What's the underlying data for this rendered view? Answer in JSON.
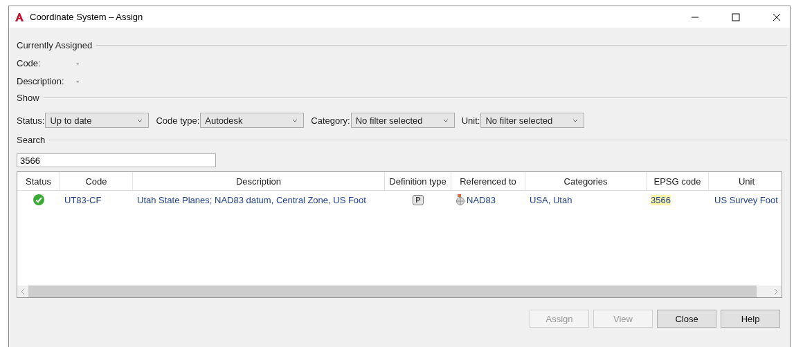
{
  "window": {
    "title": "Coordinate System – Assign"
  },
  "currently_assigned": {
    "heading": "Currently Assigned",
    "fields": [
      {
        "label": "Code:",
        "value": "-"
      },
      {
        "label": "Description:",
        "value": "-"
      }
    ]
  },
  "show": {
    "heading": "Show",
    "filters": [
      {
        "label": "Status:",
        "value": "Up to date"
      },
      {
        "label": "Code type:",
        "value": "Autodesk"
      },
      {
        "label": "Category:",
        "value": "No filter selected"
      },
      {
        "label": "Unit:",
        "value": "No filter selected"
      }
    ]
  },
  "search": {
    "heading": "Search",
    "value": "3566"
  },
  "table": {
    "columns": [
      "Status",
      "Code",
      "Description",
      "Definition type",
      "Referenced to",
      "Categories",
      "EPSG code",
      "Unit"
    ],
    "rows": [
      {
        "up_to_date": true,
        "code": "UT83-CF",
        "description": "Utah State Planes; NAD83 datum, Central Zone, US Foot",
        "definition_type": "P",
        "referenced_to": "NAD83",
        "categories": "USA, Utah",
        "epsg_code": "3566",
        "epsg_highlighted": true,
        "unit": "US Survey Foot"
      }
    ]
  },
  "buttons": [
    {
      "label": "Assign",
      "disabled": true
    },
    {
      "label": "View",
      "disabled": true
    },
    {
      "label": "Close",
      "disabled": false
    },
    {
      "label": "Help",
      "disabled": false
    }
  ]
}
